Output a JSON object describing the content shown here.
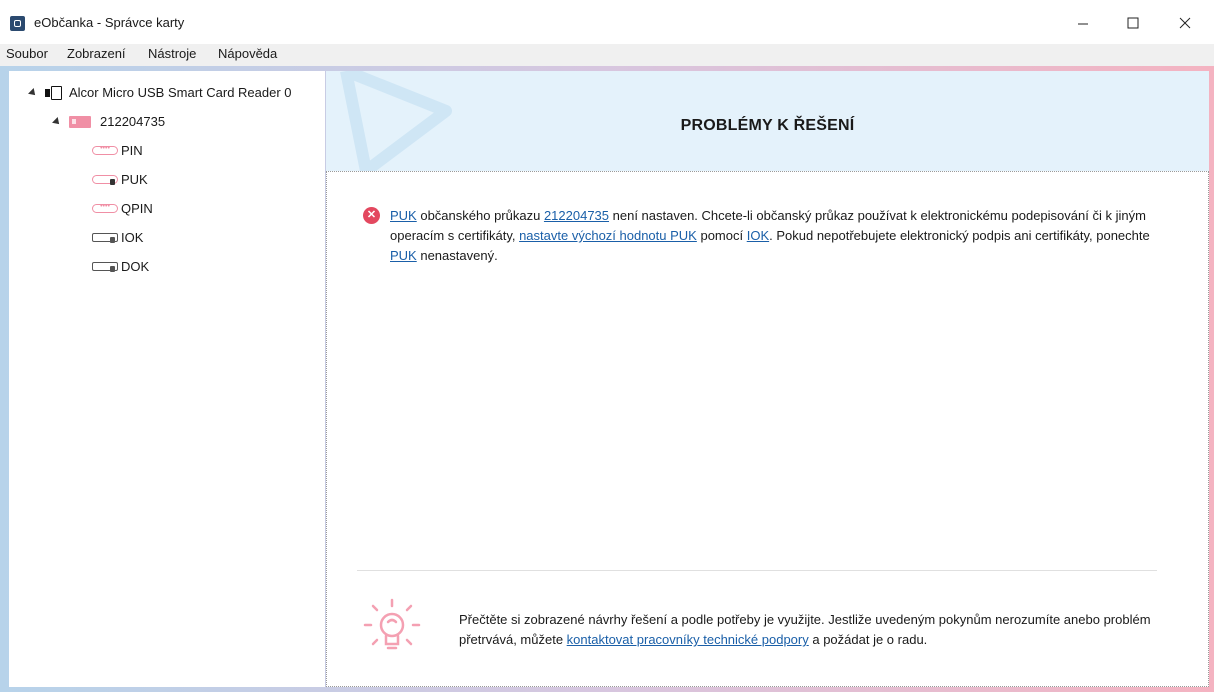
{
  "window": {
    "title": "eObčanka - Správce karty",
    "controls": [
      "minimize-icon",
      "maximize-icon",
      "close-icon"
    ]
  },
  "menu": {
    "items": [
      "Soubor",
      "Zobrazení",
      "Nástroje",
      "Nápověda"
    ]
  },
  "tree": {
    "reader": "Alcor Micro USB Smart Card Reader 0",
    "card": "212204735",
    "items": [
      {
        "label": "PIN",
        "icon": "pin-icon"
      },
      {
        "label": "PUK",
        "icon": "puk-lock-icon"
      },
      {
        "label": "QPIN",
        "icon": "pin-icon"
      },
      {
        "label": "IOK",
        "icon": "key-icon"
      },
      {
        "label": "DOK",
        "icon": "key-icon"
      }
    ]
  },
  "main": {
    "heading": "PROBLÉMY K ŘEŠENÍ",
    "issue": {
      "icon": "error-icon",
      "parts": {
        "link1": "PUK",
        "t1": " občanského průkazu ",
        "link2": "212204735",
        "t2": " není nastaven. Chcete-li občanský průkaz používat k elektronickému podepisování či k jiným operacím s certifikáty, ",
        "link3": "nastavte výchozí hodnotu PUK",
        "t3": " pomocí ",
        "link4": "IOK",
        "t4": ". Pokud nepotřebujete elektronický podpis ani certifikáty, ponechte ",
        "link5": "PUK",
        "t5": " nenastavený."
      }
    },
    "hint": {
      "icon": "lightbulb-icon",
      "t1": "Přečtěte si zobrazené návrhy řešení a podle potřeby je využijte. Jestliže uvedeným pokynům nerozumíte anebo problém přetrvává, můžete ",
      "link": "kontaktovat pracovníky technické podpory",
      "t2": " a požádat je o radu."
    }
  },
  "colors": {
    "accent_pink": "#f08fa5",
    "error_red": "#e3485f",
    "link_blue": "#1a5fa8",
    "banner_blue": "#e4f2fb"
  }
}
